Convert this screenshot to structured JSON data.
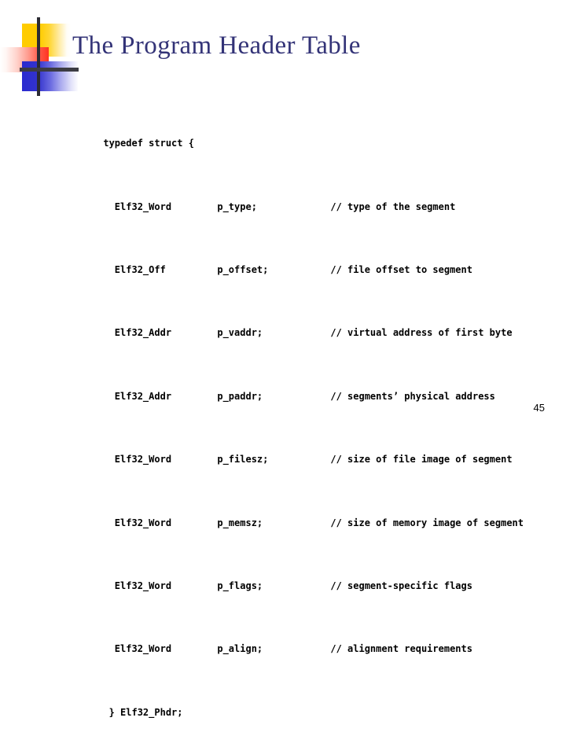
{
  "slide": {
    "title": "The Program Header Table",
    "page_number": "45",
    "title_color": "#333377",
    "background_color": "#ffffff"
  },
  "logo": {
    "name": "decorative-logo",
    "yellow_color": "#ffcc00",
    "red_color": "#ff3322",
    "blue_color": "#3333cc",
    "line_color": "#2b2b33"
  },
  "code": {
    "language": "c",
    "open_line": "typedef struct {",
    "close_line": "} Elf32_Phdr;",
    "fields": [
      {
        "type": "Elf32_Word",
        "name": "p_type;",
        "comment": "// type of the segment"
      },
      {
        "type": "Elf32_Off",
        "name": "p_offset;",
        "comment": "// file offset to segment"
      },
      {
        "type": "Elf32_Addr",
        "name": "p_vaddr;",
        "comment": "// virtual address of first byte"
      },
      {
        "type": "Elf32_Addr",
        "name": "p_paddr;",
        "comment": "// segments’ physical address"
      },
      {
        "type": "Elf32_Word",
        "name": "p_filesz;",
        "comment": "// size of file image of segment"
      },
      {
        "type": "Elf32_Word",
        "name": "p_memsz;",
        "comment": "// size of memory image of segment"
      },
      {
        "type": "Elf32_Word",
        "name": "p_flags;",
        "comment": "// segment-specific flags"
      },
      {
        "type": "Elf32_Word",
        "name": "p_align;",
        "comment": "// alignment requirements"
      }
    ]
  }
}
